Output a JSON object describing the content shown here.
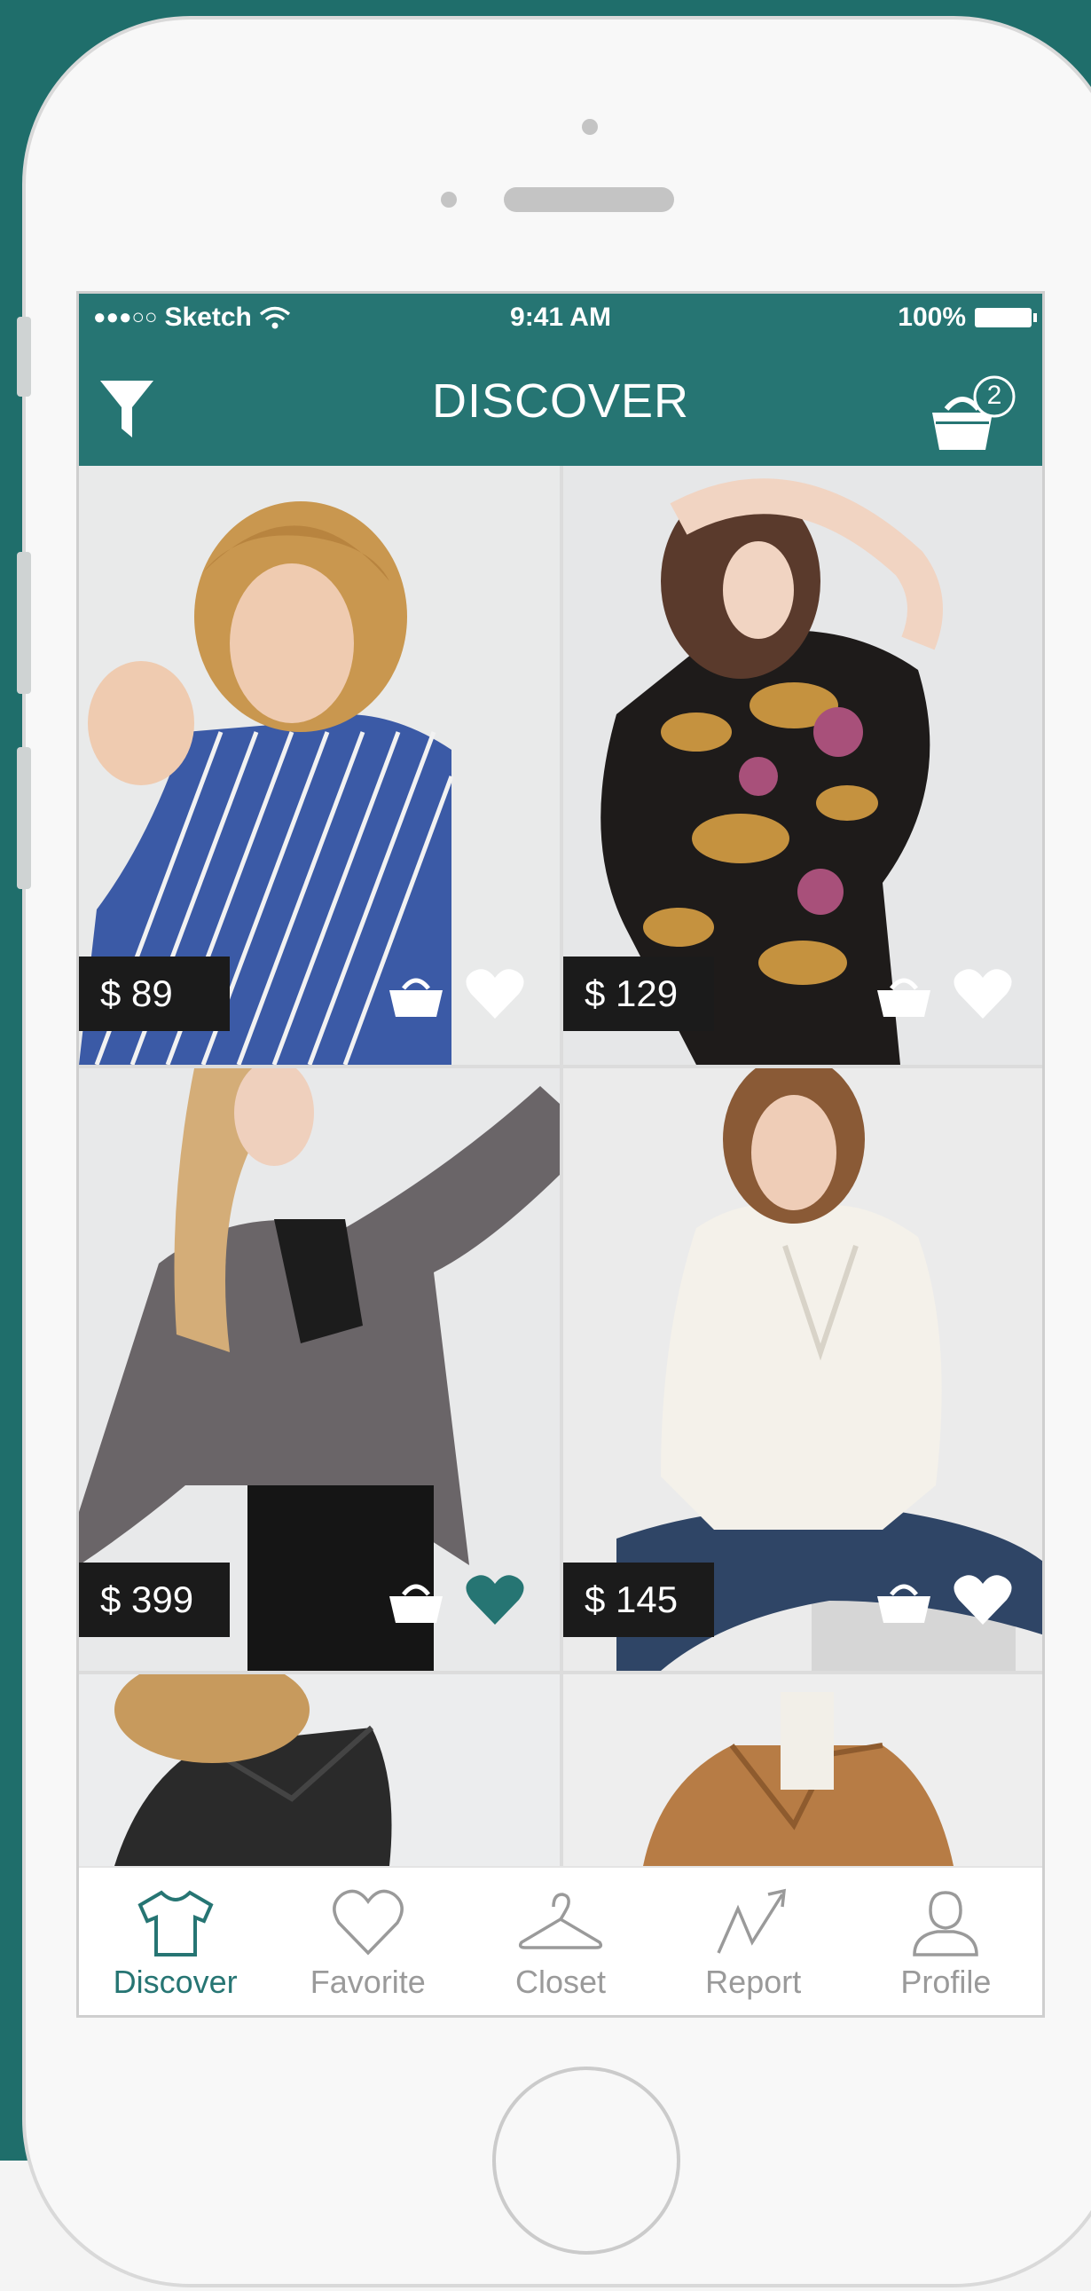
{
  "status_bar": {
    "signal": "●●●○○",
    "carrier": "Sketch",
    "time": "9:41 AM",
    "battery": "100%"
  },
  "nav": {
    "title": "DISCOVER",
    "cart_count": "2"
  },
  "products": [
    {
      "price": "$ 89",
      "favorited": false
    },
    {
      "price": "$ 129",
      "favorited": false
    },
    {
      "price": "$ 399",
      "favorited": true
    },
    {
      "price": "$ 145",
      "favorited": false
    },
    {
      "price": "",
      "favorited": false
    },
    {
      "price": "",
      "favorited": false
    }
  ],
  "tabs": [
    {
      "label": "Discover",
      "icon": "shirt-icon",
      "active": true
    },
    {
      "label": "Favorite",
      "icon": "heart-icon",
      "active": false
    },
    {
      "label": "Closet",
      "icon": "hanger-icon",
      "active": false
    },
    {
      "label": "Report",
      "icon": "trend-icon",
      "active": false
    },
    {
      "label": "Profile",
      "icon": "user-icon",
      "active": false
    }
  ],
  "colors": {
    "brand": "#267573",
    "background": "#1f6e6b",
    "favorite_active": "#267573",
    "price_tag": "#1b1b1b"
  }
}
